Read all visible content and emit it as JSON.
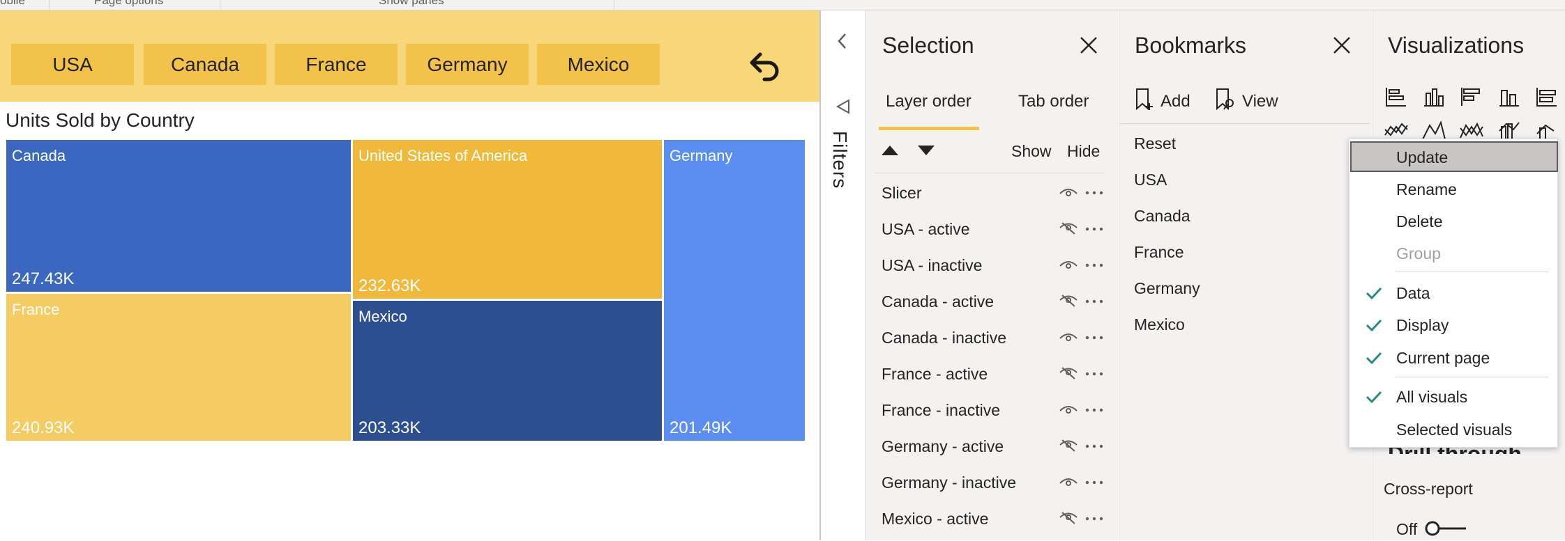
{
  "ribbon": {
    "items": [
      "obile",
      "Page options",
      "Show panes"
    ]
  },
  "slicer": {
    "buttons": [
      "USA",
      "Canada",
      "France",
      "Germany",
      "Mexico"
    ]
  },
  "chart_data": {
    "type": "treemap",
    "title": "Units Sold by Country",
    "items": [
      {
        "name": "Canada",
        "label": "247.43K",
        "value": 247.43,
        "color": "#3b67c1"
      },
      {
        "name": "United States of America",
        "label": "232.63K",
        "value": 232.63,
        "color": "#f0b93c"
      },
      {
        "name": "Germany",
        "label": "201.49K",
        "value": 201.49,
        "color": "#5b8ef0"
      },
      {
        "name": "France",
        "label": "240.93K",
        "value": 240.93,
        "color": "#f5cb63"
      },
      {
        "name": "Mexico",
        "label": "203.33K",
        "value": 203.33,
        "color": "#2e4f8f"
      }
    ]
  },
  "filters": {
    "label": "Filters"
  },
  "selection": {
    "title": "Selection",
    "tabs": [
      "Layer order",
      "Tab order"
    ],
    "show_label": "Show",
    "hide_label": "Hide",
    "layers": [
      {
        "name": "Slicer",
        "hidden": false
      },
      {
        "name": "USA - active",
        "hidden": true
      },
      {
        "name": "USA - inactive",
        "hidden": false
      },
      {
        "name": "Canada - active",
        "hidden": true
      },
      {
        "name": "Canada - inactive",
        "hidden": false
      },
      {
        "name": "France - active",
        "hidden": true
      },
      {
        "name": "France - inactive",
        "hidden": false
      },
      {
        "name": "Germany - active",
        "hidden": true
      },
      {
        "name": "Germany - inactive",
        "hidden": false
      },
      {
        "name": "Mexico - active",
        "hidden": true
      }
    ]
  },
  "bookmarks": {
    "title": "Bookmarks",
    "add_label": "Add",
    "view_label": "View",
    "items": [
      "Reset",
      "USA",
      "Canada",
      "France",
      "Germany",
      "Mexico"
    ]
  },
  "context_menu": {
    "items": [
      {
        "label": "Update",
        "checked": false,
        "disabled": false,
        "selected": true
      },
      {
        "label": "Rename",
        "checked": false,
        "disabled": false,
        "selected": false
      },
      {
        "label": "Delete",
        "checked": false,
        "disabled": false,
        "selected": false
      },
      {
        "label": "Group",
        "checked": false,
        "disabled": true,
        "selected": false
      },
      {
        "label": "Data",
        "checked": true,
        "disabled": false,
        "selected": false
      },
      {
        "label": "Display",
        "checked": true,
        "disabled": false,
        "selected": false
      },
      {
        "label": "Current page",
        "checked": true,
        "disabled": false,
        "selected": false
      },
      {
        "label": "All visuals",
        "checked": true,
        "disabled": false,
        "selected": false
      },
      {
        "label": "Selected visuals",
        "checked": false,
        "disabled": false,
        "selected": false
      }
    ]
  },
  "visualizations": {
    "title": "Visualizations",
    "partial_heading": "Drill through",
    "cross_report_label": "Cross-report",
    "toggle_label": "Off"
  },
  "colors": {
    "accent_yellow": "#f2c24a",
    "band_yellow": "#f7d77a",
    "pane_bg": "#f3f2f1",
    "check_teal": "#2b8a7e"
  }
}
